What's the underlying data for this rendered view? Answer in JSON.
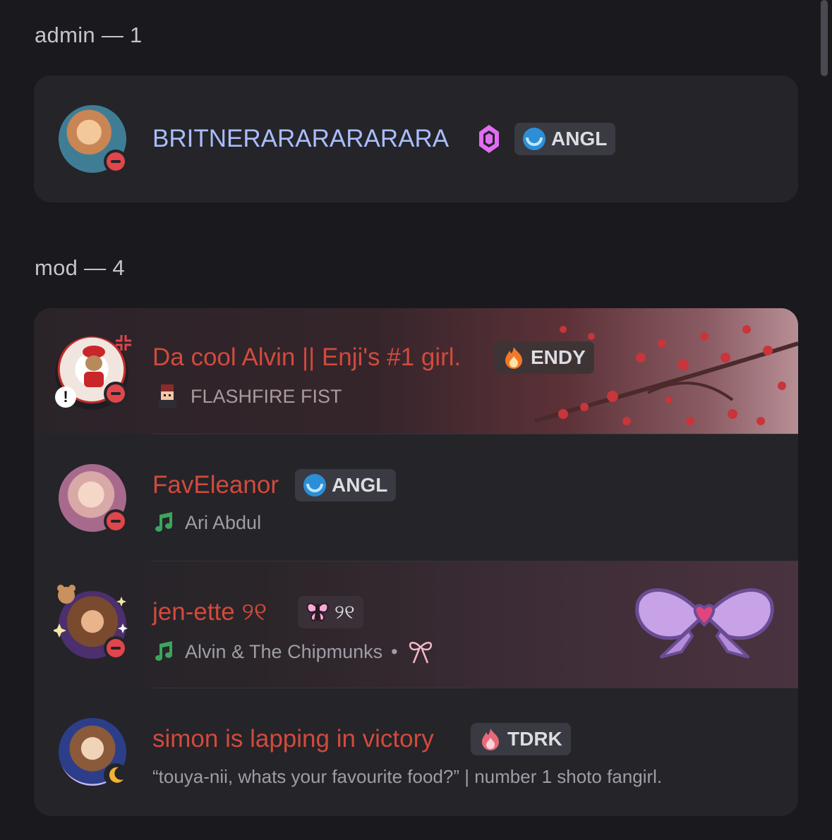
{
  "sections": {
    "admin": {
      "title": "admin — 1"
    },
    "mod": {
      "title": "mod — 4"
    }
  },
  "members": {
    "britne": {
      "name": "BRITNERARARARARARA",
      "tag": "ANGL",
      "name_color": "#a9bdfb"
    },
    "alvin": {
      "name": "Da cool Alvin || Enji's #1 girl.",
      "tag": "ENDY",
      "status_text": "FLASHFIRE FIST",
      "name_color": "#d24a3c"
    },
    "eleanor": {
      "name": "FavEleanor",
      "tag": "ANGL",
      "status_text": "Ari Abdul",
      "name_color": "#d24a3c"
    },
    "jenette": {
      "name": "jen-ette ୨୧",
      "tag": "୨୧",
      "status_text": "Alvin & The Chipmunks",
      "separator": "•",
      "name_color": "#d24a3c"
    },
    "simon": {
      "name": "simon is lapping in victory",
      "tag": "TDRK",
      "status_text": "“touya-nii, whats your favourite food?” | number 1 shoto fangirl.",
      "name_color": "#d24a3c"
    }
  },
  "icons": {
    "status_dnd": "do-not-disturb-icon",
    "status_idle": "idle-moon-icon",
    "music": "music-note-icon",
    "boost": "nitro-boost-gem-icon"
  },
  "colors": {
    "dnd": "#e0464b",
    "idle": "#f0b232",
    "music": "#3ba55c"
  }
}
